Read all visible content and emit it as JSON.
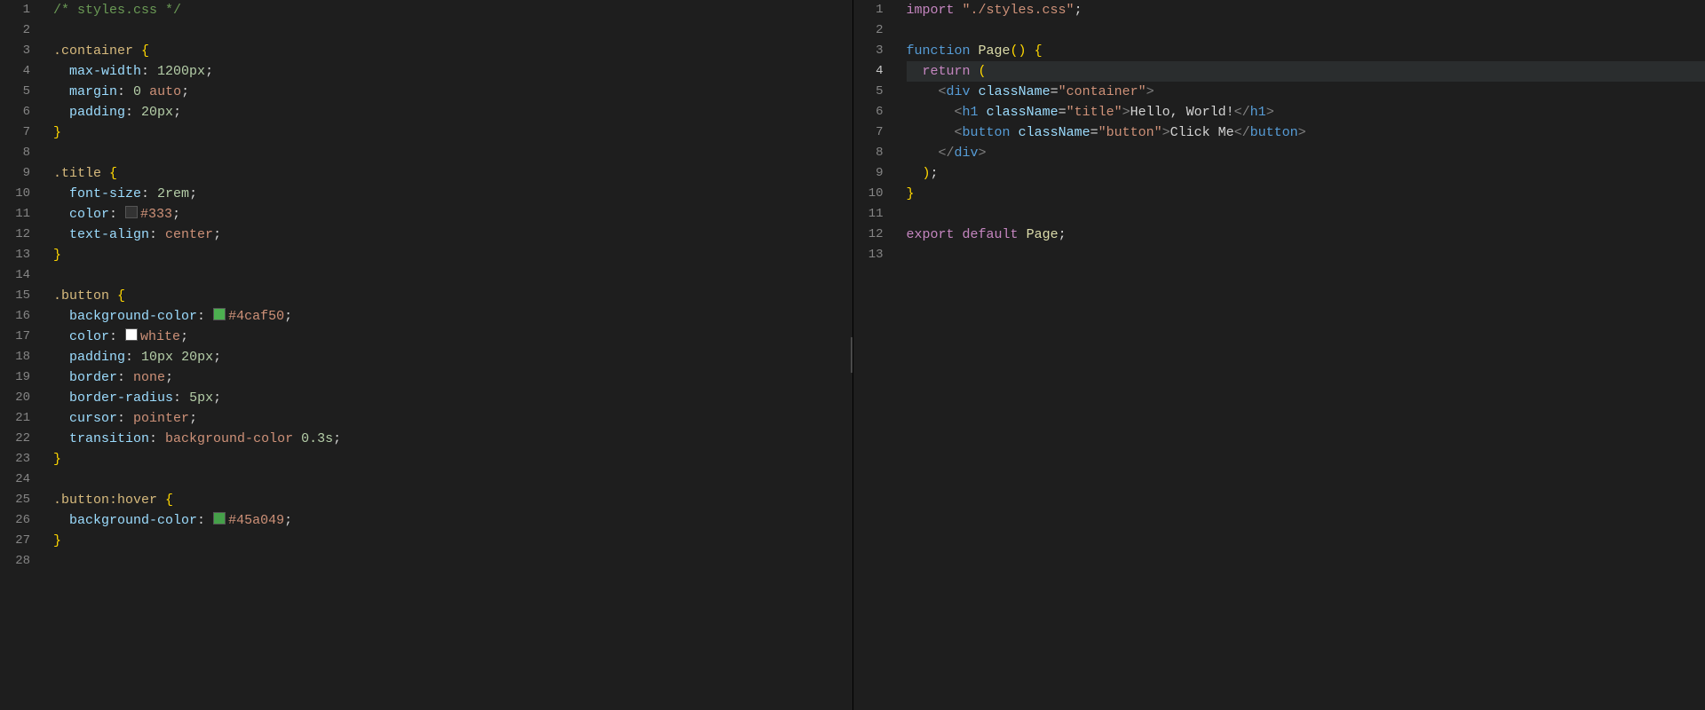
{
  "left": {
    "currentLine": 0,
    "lines": [
      {
        "n": 1,
        "tokens": [
          {
            "t": "/* styles.css */",
            "c": "c-comment"
          }
        ]
      },
      {
        "n": 2,
        "tokens": []
      },
      {
        "n": 3,
        "tokens": [
          {
            "t": ".container",
            "c": "c-selector"
          },
          {
            "t": " ",
            "c": "c-wht"
          },
          {
            "t": "{",
            "c": "c-brace"
          }
        ]
      },
      {
        "n": 4,
        "tokens": [
          {
            "t": "  ",
            "c": "c-wht"
          },
          {
            "t": "max-width",
            "c": "c-prop"
          },
          {
            "t": ": ",
            "c": "c-wht"
          },
          {
            "t": "1200px",
            "c": "c-num"
          },
          {
            "t": ";",
            "c": "c-wht"
          }
        ]
      },
      {
        "n": 5,
        "tokens": [
          {
            "t": "  ",
            "c": "c-wht"
          },
          {
            "t": "margin",
            "c": "c-prop"
          },
          {
            "t": ": ",
            "c": "c-wht"
          },
          {
            "t": "0",
            "c": "c-num"
          },
          {
            "t": " ",
            "c": "c-wht"
          },
          {
            "t": "auto",
            "c": "c-val"
          },
          {
            "t": ";",
            "c": "c-wht"
          }
        ]
      },
      {
        "n": 6,
        "tokens": [
          {
            "t": "  ",
            "c": "c-wht"
          },
          {
            "t": "padding",
            "c": "c-prop"
          },
          {
            "t": ": ",
            "c": "c-wht"
          },
          {
            "t": "20px",
            "c": "c-num"
          },
          {
            "t": ";",
            "c": "c-wht"
          }
        ]
      },
      {
        "n": 7,
        "tokens": [
          {
            "t": "}",
            "c": "c-brace"
          }
        ]
      },
      {
        "n": 8,
        "tokens": []
      },
      {
        "n": 9,
        "tokens": [
          {
            "t": ".title",
            "c": "c-selector"
          },
          {
            "t": " ",
            "c": "c-wht"
          },
          {
            "t": "{",
            "c": "c-brace"
          }
        ]
      },
      {
        "n": 10,
        "tokens": [
          {
            "t": "  ",
            "c": "c-wht"
          },
          {
            "t": "font-size",
            "c": "c-prop"
          },
          {
            "t": ": ",
            "c": "c-wht"
          },
          {
            "t": "2rem",
            "c": "c-num"
          },
          {
            "t": ";",
            "c": "c-wht"
          }
        ]
      },
      {
        "n": 11,
        "tokens": [
          {
            "t": "  ",
            "c": "c-wht"
          },
          {
            "t": "color",
            "c": "c-prop"
          },
          {
            "t": ": ",
            "c": "c-wht"
          },
          {
            "box": "#333333"
          },
          {
            "t": "#333",
            "c": "c-val"
          },
          {
            "t": ";",
            "c": "c-wht"
          }
        ]
      },
      {
        "n": 12,
        "tokens": [
          {
            "t": "  ",
            "c": "c-wht"
          },
          {
            "t": "text-align",
            "c": "c-prop"
          },
          {
            "t": ": ",
            "c": "c-wht"
          },
          {
            "t": "center",
            "c": "c-val"
          },
          {
            "t": ";",
            "c": "c-wht"
          }
        ]
      },
      {
        "n": 13,
        "tokens": [
          {
            "t": "}",
            "c": "c-brace"
          }
        ]
      },
      {
        "n": 14,
        "tokens": []
      },
      {
        "n": 15,
        "tokens": [
          {
            "t": ".button",
            "c": "c-selector"
          },
          {
            "t": " ",
            "c": "c-wht"
          },
          {
            "t": "{",
            "c": "c-brace"
          }
        ]
      },
      {
        "n": 16,
        "tokens": [
          {
            "t": "  ",
            "c": "c-wht"
          },
          {
            "t": "background-color",
            "c": "c-prop"
          },
          {
            "t": ": ",
            "c": "c-wht"
          },
          {
            "box": "#4caf50"
          },
          {
            "t": "#4caf50",
            "c": "c-val"
          },
          {
            "t": ";",
            "c": "c-wht"
          }
        ]
      },
      {
        "n": 17,
        "tokens": [
          {
            "t": "  ",
            "c": "c-wht"
          },
          {
            "t": "color",
            "c": "c-prop"
          },
          {
            "t": ": ",
            "c": "c-wht"
          },
          {
            "box": "#ffffff"
          },
          {
            "t": "white",
            "c": "c-val"
          },
          {
            "t": ";",
            "c": "c-wht"
          }
        ]
      },
      {
        "n": 18,
        "tokens": [
          {
            "t": "  ",
            "c": "c-wht"
          },
          {
            "t": "padding",
            "c": "c-prop"
          },
          {
            "t": ": ",
            "c": "c-wht"
          },
          {
            "t": "10px",
            "c": "c-num"
          },
          {
            "t": " ",
            "c": "c-wht"
          },
          {
            "t": "20px",
            "c": "c-num"
          },
          {
            "t": ";",
            "c": "c-wht"
          }
        ]
      },
      {
        "n": 19,
        "tokens": [
          {
            "t": "  ",
            "c": "c-wht"
          },
          {
            "t": "border",
            "c": "c-prop"
          },
          {
            "t": ": ",
            "c": "c-wht"
          },
          {
            "t": "none",
            "c": "c-val"
          },
          {
            "t": ";",
            "c": "c-wht"
          }
        ]
      },
      {
        "n": 20,
        "tokens": [
          {
            "t": "  ",
            "c": "c-wht"
          },
          {
            "t": "border-radius",
            "c": "c-prop"
          },
          {
            "t": ": ",
            "c": "c-wht"
          },
          {
            "t": "5px",
            "c": "c-num"
          },
          {
            "t": ";",
            "c": "c-wht"
          }
        ]
      },
      {
        "n": 21,
        "tokens": [
          {
            "t": "  ",
            "c": "c-wht"
          },
          {
            "t": "cursor",
            "c": "c-prop"
          },
          {
            "t": ": ",
            "c": "c-wht"
          },
          {
            "t": "pointer",
            "c": "c-val"
          },
          {
            "t": ";",
            "c": "c-wht"
          }
        ]
      },
      {
        "n": 22,
        "tokens": [
          {
            "t": "  ",
            "c": "c-wht"
          },
          {
            "t": "transition",
            "c": "c-prop"
          },
          {
            "t": ": ",
            "c": "c-wht"
          },
          {
            "t": "background-color ",
            "c": "c-val"
          },
          {
            "t": "0.3s",
            "c": "c-num"
          },
          {
            "t": ";",
            "c": "c-wht"
          }
        ]
      },
      {
        "n": 23,
        "tokens": [
          {
            "t": "}",
            "c": "c-brace"
          }
        ]
      },
      {
        "n": 24,
        "tokens": []
      },
      {
        "n": 25,
        "tokens": [
          {
            "t": ".button:hover",
            "c": "c-selector"
          },
          {
            "t": " ",
            "c": "c-wht"
          },
          {
            "t": "{",
            "c": "c-brace"
          }
        ]
      },
      {
        "n": 26,
        "tokens": [
          {
            "t": "  ",
            "c": "c-wht"
          },
          {
            "t": "background-color",
            "c": "c-prop"
          },
          {
            "t": ": ",
            "c": "c-wht"
          },
          {
            "box": "#45a049"
          },
          {
            "t": "#45a049",
            "c": "c-val"
          },
          {
            "t": ";",
            "c": "c-wht"
          }
        ]
      },
      {
        "n": 27,
        "tokens": [
          {
            "t": "}",
            "c": "c-brace"
          }
        ]
      },
      {
        "n": 28,
        "tokens": []
      }
    ]
  },
  "right": {
    "currentLine": 4,
    "lines": [
      {
        "n": 1,
        "tokens": [
          {
            "t": "import",
            "c": "c-kw"
          },
          {
            "t": " ",
            "c": "c-wht"
          },
          {
            "t": "\"./styles.css\"",
            "c": "c-string"
          },
          {
            "t": ";",
            "c": "c-punc"
          }
        ]
      },
      {
        "n": 2,
        "tokens": []
      },
      {
        "n": 3,
        "tokens": [
          {
            "t": "function",
            "c": "c-tagname"
          },
          {
            "t": " ",
            "c": "c-wht"
          },
          {
            "t": "Page",
            "c": "c-fn"
          },
          {
            "t": "()",
            "c": "c-brace"
          },
          {
            "t": " ",
            "c": "c-wht"
          },
          {
            "t": "{",
            "c": "c-brace"
          }
        ]
      },
      {
        "n": 4,
        "tokens": [
          {
            "t": "  ",
            "c": "c-wht"
          },
          {
            "t": "return",
            "c": "c-kw"
          },
          {
            "t": " ",
            "c": "c-wht"
          },
          {
            "t": "(",
            "c": "c-brace"
          }
        ]
      },
      {
        "n": 5,
        "tokens": [
          {
            "t": "    ",
            "c": "c-wht"
          },
          {
            "t": "<",
            "c": "c-tag"
          },
          {
            "t": "div",
            "c": "c-tagname"
          },
          {
            "t": " ",
            "c": "c-wht"
          },
          {
            "t": "className",
            "c": "c-attr"
          },
          {
            "t": "=",
            "c": "c-punc"
          },
          {
            "t": "\"container\"",
            "c": "c-string"
          },
          {
            "t": ">",
            "c": "c-tag"
          }
        ]
      },
      {
        "n": 6,
        "tokens": [
          {
            "t": "      ",
            "c": "c-wht"
          },
          {
            "t": "<",
            "c": "c-tag"
          },
          {
            "t": "h1",
            "c": "c-tagname"
          },
          {
            "t": " ",
            "c": "c-wht"
          },
          {
            "t": "className",
            "c": "c-attr"
          },
          {
            "t": "=",
            "c": "c-punc"
          },
          {
            "t": "\"title\"",
            "c": "c-string"
          },
          {
            "t": ">",
            "c": "c-tag"
          },
          {
            "t": "Hello, World!",
            "c": "c-wht"
          },
          {
            "t": "</",
            "c": "c-tag"
          },
          {
            "t": "h1",
            "c": "c-tagname"
          },
          {
            "t": ">",
            "c": "c-tag"
          }
        ]
      },
      {
        "n": 7,
        "tokens": [
          {
            "t": "      ",
            "c": "c-wht"
          },
          {
            "t": "<",
            "c": "c-tag"
          },
          {
            "t": "button",
            "c": "c-tagname"
          },
          {
            "t": " ",
            "c": "c-wht"
          },
          {
            "t": "className",
            "c": "c-attr"
          },
          {
            "t": "=",
            "c": "c-punc"
          },
          {
            "t": "\"button\"",
            "c": "c-string"
          },
          {
            "t": ">",
            "c": "c-tag"
          },
          {
            "t": "Click Me",
            "c": "c-wht"
          },
          {
            "t": "</",
            "c": "c-tag"
          },
          {
            "t": "button",
            "c": "c-tagname"
          },
          {
            "t": ">",
            "c": "c-tag"
          }
        ]
      },
      {
        "n": 8,
        "tokens": [
          {
            "t": "    ",
            "c": "c-wht"
          },
          {
            "t": "</",
            "c": "c-tag"
          },
          {
            "t": "div",
            "c": "c-tagname"
          },
          {
            "t": ">",
            "c": "c-tag"
          }
        ]
      },
      {
        "n": 9,
        "tokens": [
          {
            "t": "  ",
            "c": "c-wht"
          },
          {
            "t": ")",
            "c": "c-brace"
          },
          {
            "t": ";",
            "c": "c-punc"
          }
        ]
      },
      {
        "n": 10,
        "tokens": [
          {
            "t": "}",
            "c": "c-brace"
          }
        ]
      },
      {
        "n": 11,
        "tokens": []
      },
      {
        "n": 12,
        "tokens": [
          {
            "t": "export",
            "c": "c-kw"
          },
          {
            "t": " ",
            "c": "c-wht"
          },
          {
            "t": "default",
            "c": "c-kw"
          },
          {
            "t": " ",
            "c": "c-wht"
          },
          {
            "t": "Page",
            "c": "c-fn"
          },
          {
            "t": ";",
            "c": "c-punc"
          }
        ]
      },
      {
        "n": 13,
        "tokens": []
      }
    ]
  }
}
